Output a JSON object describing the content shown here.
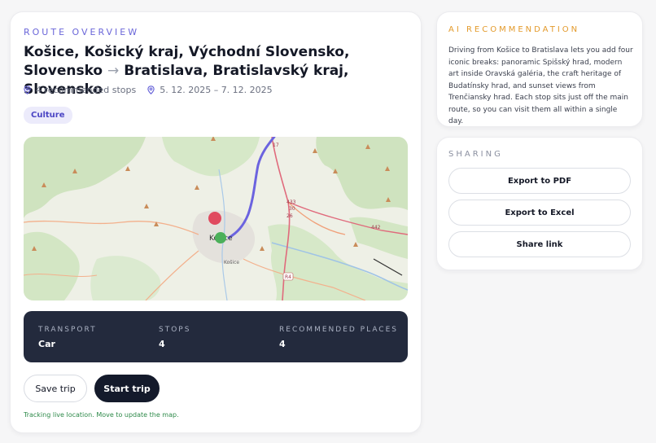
{
  "route": {
    "overline": "ROUTE OVERVIEW",
    "from": "Košice, Košický kraj, Východní Slovensko, Slovensko",
    "arrow": "→",
    "to": "Bratislava, Bratislavský kraj, Slovensko",
    "stops_text": "4 recommended stops",
    "dates_text": "5. 12. 2025 – 7. 12. 2025",
    "tag": "Culture"
  },
  "map": {
    "city_label": "Košice",
    "city_label_small": "Košice",
    "road_labels": [
      "17",
      "433",
      "30",
      "26",
      "442",
      "R4"
    ],
    "marker_colors": {
      "stop": "#e04a5f",
      "current": "#4cb05a"
    },
    "route_color": "#6b63df",
    "icons": [
      "map-pin-icon",
      "calendar-icon"
    ]
  },
  "stats": {
    "transport_label": "TRANSPORT",
    "transport_value": "Car",
    "stops_label": "STOPS",
    "stops_value": "4",
    "places_label": "RECOMMENDED PLACES",
    "places_value": "4"
  },
  "actions": {
    "save_label": "Save trip",
    "start_label": "Start trip"
  },
  "tracking_text": "Tracking live location. Move to update the map.",
  "ai": {
    "overline": "AI RECOMMENDATION",
    "text": "Driving from Košice to Bratislava lets you add four iconic breaks: panoramic Spišský hrad, modern art inside Oravská galéria, the craft heritage of Budatínsky hrad, and sunset views from Trenčiansky hrad. Each stop sits just off the main route, so you can visit them all within a single day."
  },
  "sharing": {
    "overline": "SHARING",
    "export_pdf": "Export to PDF",
    "export_excel": "Export to Excel",
    "share_link": "Share link"
  },
  "colors": {
    "accent": "#6a66d9",
    "ai_accent": "#e39a2b",
    "dark_panel": "#232a3d",
    "primary_button": "#141a2b",
    "tracking": "#2e8a4a"
  }
}
